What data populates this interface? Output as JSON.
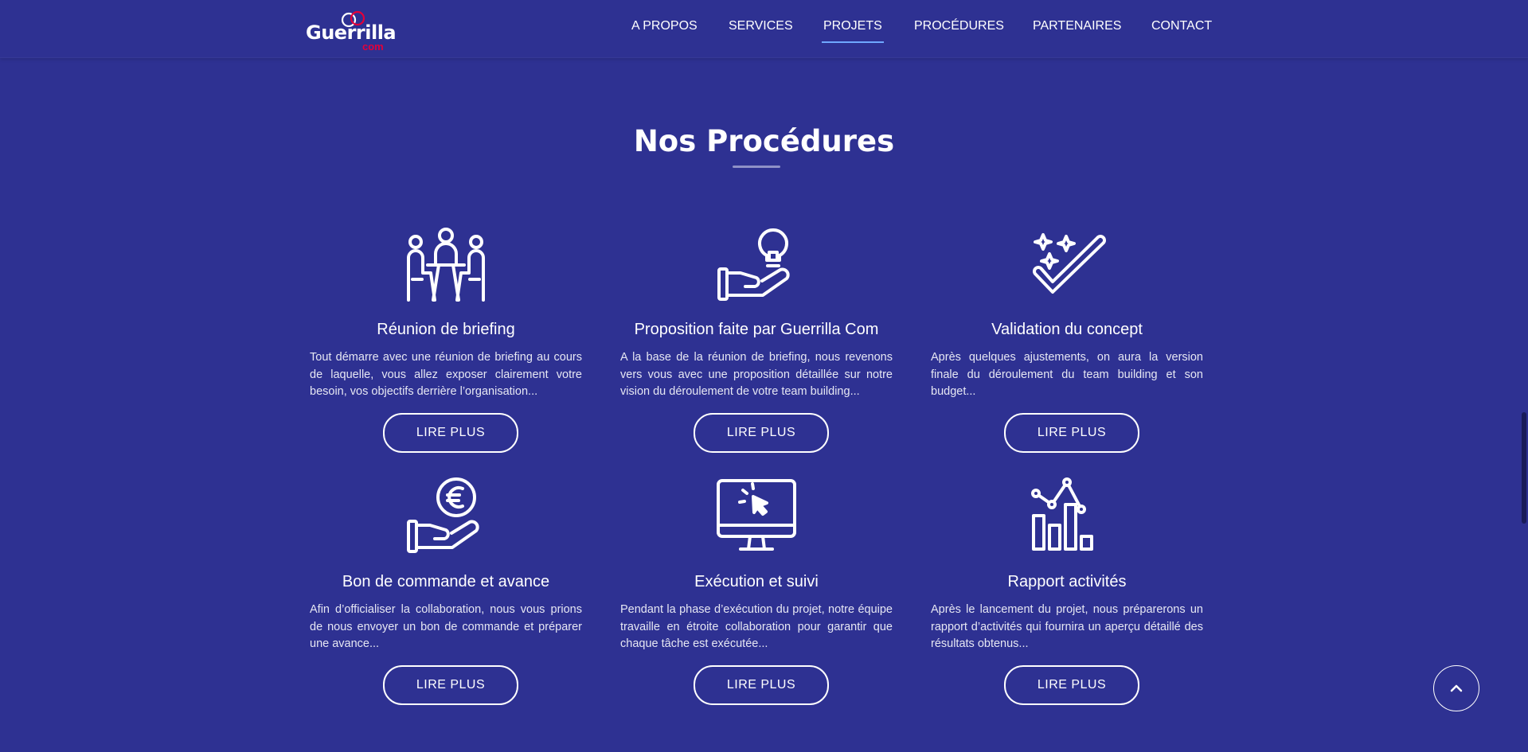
{
  "header": {
    "logo": {
      "name": "Guerrilla",
      "sub": "com"
    },
    "nav": [
      {
        "label": "A PROPOS",
        "active": false
      },
      {
        "label": "SERVICES",
        "active": false
      },
      {
        "label": "PROJETS",
        "active": true
      },
      {
        "label": "PROCÉDURES",
        "active": false
      },
      {
        "label": "PARTENAIRES",
        "active": false
      },
      {
        "label": "CONTACT",
        "active": false
      }
    ]
  },
  "section": {
    "title": "Nos Procédures",
    "cards": [
      {
        "icon": "meeting-icon",
        "title": "Réunion de briefing",
        "text": "Tout démarre avec une réunion de briefing au cours de laquelle, vous allez exposer clairement votre besoin, vos objectifs derrière l’organisation...",
        "button": "LIRE PLUS"
      },
      {
        "icon": "idea-hand-icon",
        "title": "Proposition faite par Guerrilla Com",
        "text": "A la base de la réunion de briefing, nous revenons vers vous avec une proposition détaillée sur notre vision du déroulement de votre team building...",
        "button": "LIRE PLUS"
      },
      {
        "icon": "check-sparkle-icon",
        "title": "Validation du concept",
        "text": "Après quelques ajustements, on aura la version finale du déroulement du team building et son budget...",
        "button": "LIRE PLUS"
      },
      {
        "icon": "euro-hand-icon",
        "title": "Bon de commande et avance",
        "text": "Afin d’officialiser la collaboration, nous vous prions de nous envoyer un bon de commande et préparer une avance...",
        "button": "LIRE PLUS"
      },
      {
        "icon": "monitor-click-icon",
        "title": "Exécution et suivi",
        "text": "Pendant la phase d’exécution du projet, notre équipe travaille en étroite collaboration pour garantir que chaque tâche est exécutée...",
        "button": "LIRE PLUS"
      },
      {
        "icon": "bar-chart-icon",
        "title": "Rapport activités",
        "text": "Après le lancement du projet, nous préparerons un rapport d’activités qui fournira un aperçu détaillé des résultats obtenus...",
        "button": "LIRE PLUS"
      }
    ]
  },
  "colors": {
    "background": "#2e3192",
    "accent_underline": "#6fa8ff",
    "logo_red": "#e4003a"
  },
  "scroll_top": {
    "icon": "chevron-up-icon"
  }
}
